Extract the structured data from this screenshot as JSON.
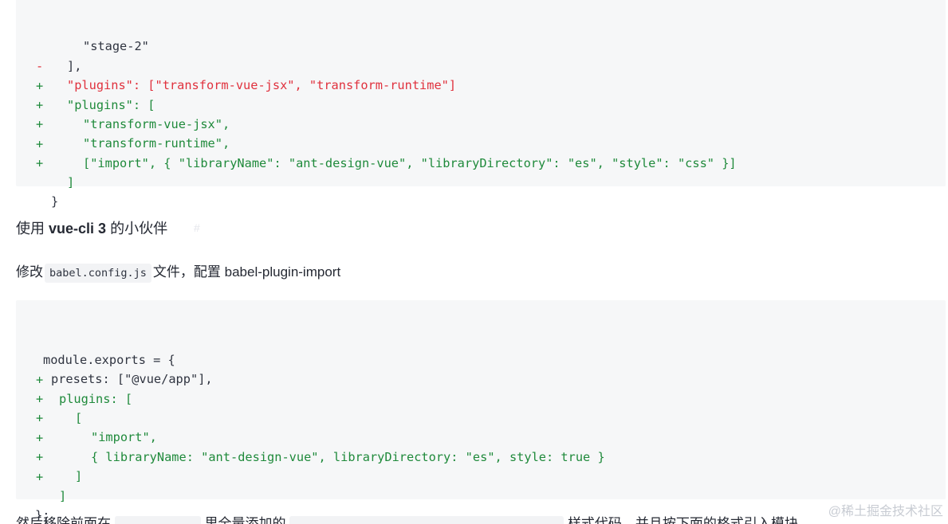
{
  "code_block_1": {
    "lines": [
      {
        "mark": "",
        "type": "normal",
        "text": "\"stage-2\""
      },
      {
        "mark": "",
        "type": "normal",
        "text": "],"
      },
      {
        "mark": "-",
        "type": "removed",
        "text": "\"plugins\": [\"transform-vue-jsx\", \"transform-runtime\"]"
      },
      {
        "mark": "+",
        "type": "added",
        "text": "\"plugins\": ["
      },
      {
        "mark": "+",
        "type": "added",
        "text": "\"transform-vue-jsx\","
      },
      {
        "mark": "+",
        "type": "added",
        "text": "\"transform-runtime\","
      },
      {
        "mark": "+",
        "type": "added",
        "text": "[\"import\", { \"libraryName\": \"ant-design-vue\", \"libraryDirectory\": \"es\", \"style\": \"css\" }]"
      },
      {
        "mark": "+",
        "type": "added",
        "text": "]"
      },
      {
        "mark": "",
        "type": "normal",
        "text": "}"
      }
    ]
  },
  "section": {
    "heading_prefix": "使用 ",
    "heading_bold": "vue-cli 3",
    "heading_suffix": " 的小伙伴",
    "anchor": "#",
    "para_prefix": "修改",
    "para_code": "babel.config.js",
    "para_suffix": "文件，配置 babel-plugin-import"
  },
  "code_block_2": {
    "lines": [
      {
        "mark": "",
        "type": "normal",
        "text": "module.exports = {"
      },
      {
        "mark": "",
        "type": "normal",
        "text": "presets: [\"@vue/app\"],"
      },
      {
        "mark": "+",
        "type": "added",
        "text": "plugins: ["
      },
      {
        "mark": "+",
        "type": "added",
        "text": "["
      },
      {
        "mark": "+",
        "type": "added",
        "text": "\"import\","
      },
      {
        "mark": "+",
        "type": "added",
        "text": "{ libraryName: \"ant-design-vue\", libraryDirectory: \"es\", style: true }"
      },
      {
        "mark": "+",
        "type": "added",
        "text": "]"
      },
      {
        "mark": "+",
        "type": "added",
        "text": "]"
      },
      {
        "mark": "",
        "type": "normal",
        "text": "};"
      }
    ]
  },
  "cut_off_text": {
    "part1": "然后移除前面在",
    "part2": "里全量添加的",
    "part3": "样式代码，并且按下面的格式引入模块"
  },
  "watermark": "@稀土掘金技术社区",
  "colors": {
    "added": "#1f8a3b",
    "removed": "#e0313d",
    "code_bg": "#f6f7f8"
  }
}
